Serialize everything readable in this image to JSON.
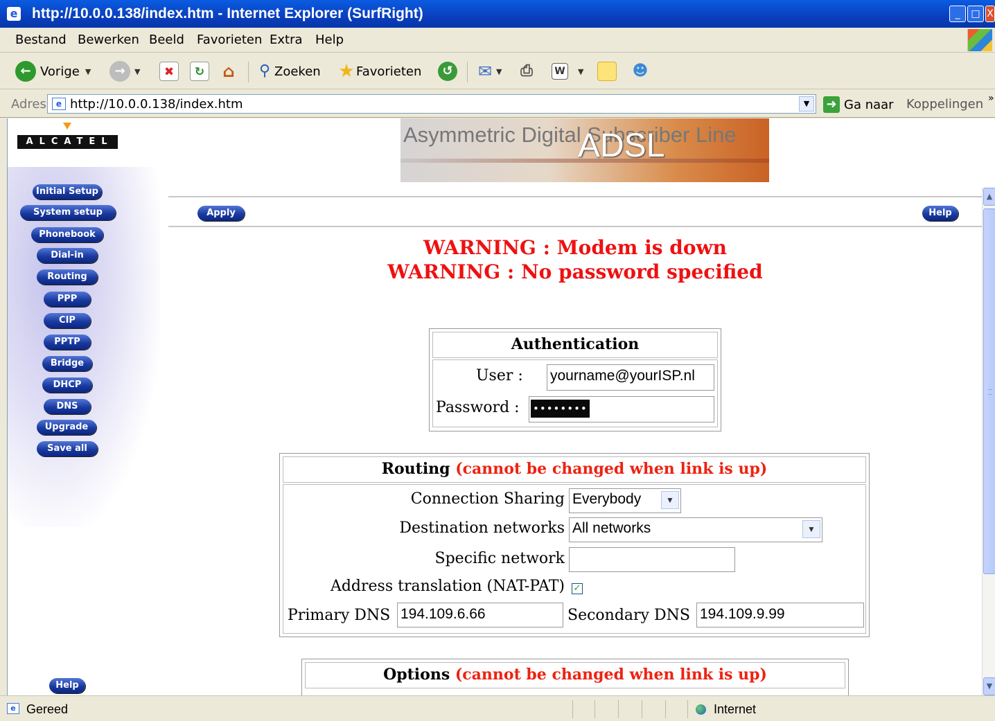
{
  "window": {
    "title": "http://10.0.0.138/index.htm - Internet Explorer (SurfRight)",
    "controls": [
      "_",
      "□",
      "X"
    ]
  },
  "menubar": {
    "items": [
      "Bestand",
      "Bewerken",
      "Beeld",
      "Favorieten",
      "Extra",
      "Help"
    ]
  },
  "toolbar": {
    "back_label": "Vorige",
    "search_label": "Zoeken",
    "favorites_label": "Favorieten"
  },
  "address": {
    "label": "Adres",
    "url": "http://10.0.0.138/index.htm",
    "go_label": "Ga naar",
    "links_label": "Koppelingen"
  },
  "page": {
    "logo_text": "ALCATEL",
    "banner_top": "Asymmetric Digital Subscriber Line",
    "banner_main": "ADSL",
    "nav": [
      "Initial Setup",
      "System setup",
      "Phonebook",
      "Dial-in",
      "Routing",
      "PPP",
      "CIP",
      "PPTP",
      "Bridge",
      "DHCP",
      "DNS",
      "Upgrade",
      "Save all"
    ],
    "nav_help": "Help",
    "apply_label": "Apply",
    "help_label": "Help",
    "warnings": [
      "WARNING : Modem is down",
      "WARNING : No password specified"
    ],
    "auth": {
      "title": "Authentication",
      "user_label": "User :",
      "user_value": "yourname@yourISP.nl",
      "password_label": "Password :",
      "password_value": "••••••••"
    },
    "routing": {
      "title": "Routing",
      "title_note": "(cannot be changed when link is up)",
      "connection_sharing_label": "Connection Sharing",
      "connection_sharing_value": "Everybody",
      "destination_label": "Destination networks",
      "destination_value": "All networks",
      "specific_label": "Specific network",
      "specific_value": "",
      "nat_label": "Address translation (NAT-PAT)",
      "nat_checked": true,
      "primary_dns_label": "Primary DNS",
      "primary_dns_value": "194.109.6.66",
      "secondary_dns_label": "Secondary DNS",
      "secondary_dns_value": "194.109.9.99"
    },
    "options": {
      "title": "Options",
      "title_note": "(cannot be changed when link is up)"
    }
  },
  "statusbar": {
    "status": "Gereed",
    "zone": "Internet"
  }
}
